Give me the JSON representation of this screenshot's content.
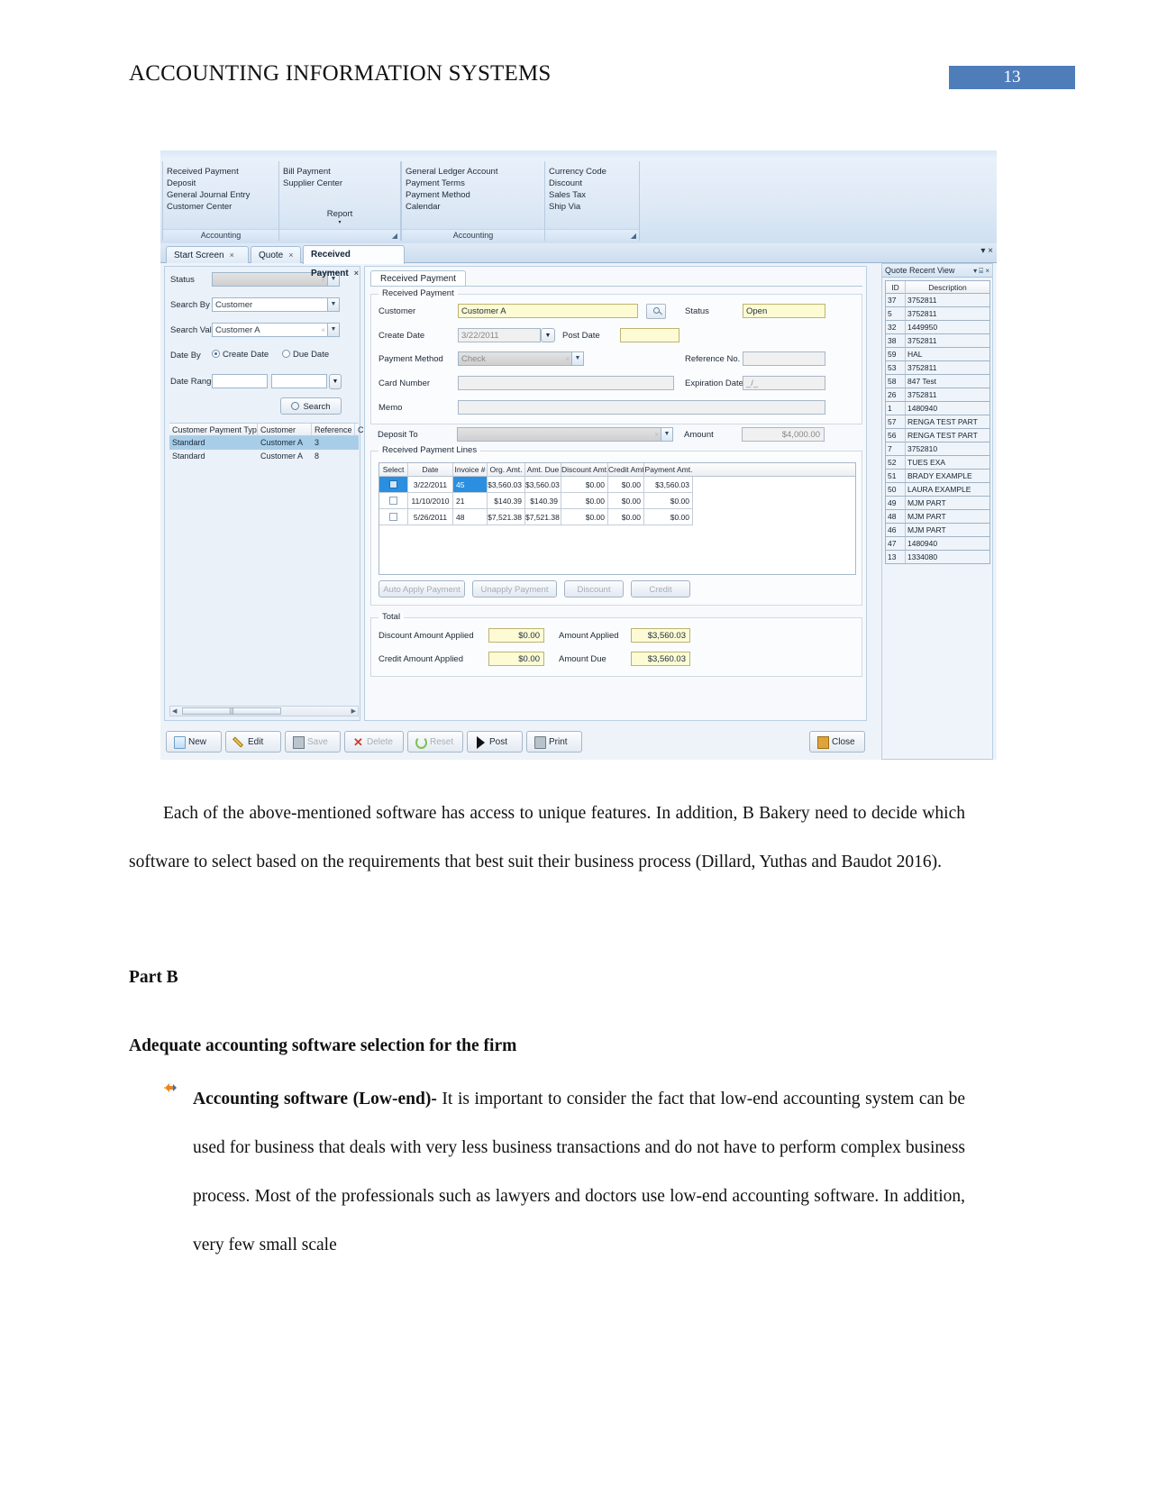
{
  "header": {
    "running_title": "ACCOUNTING INFORMATION SYSTEMS",
    "page_number": "13",
    "accent_color": "#4f7dba"
  },
  "screenshot": {
    "ribbon": {
      "group1": {
        "caption": "Accounting",
        "items": [
          "Received Payment",
          "Deposit",
          "General Journal Entry",
          "Customer Center"
        ]
      },
      "group2": {
        "items": [
          "Bill Payment",
          "Supplier Center"
        ],
        "report_label": "Report"
      },
      "group3": {
        "caption": "Accounting",
        "items": [
          "General Ledger Account",
          "Payment Terms",
          "Payment Method",
          "Calendar"
        ]
      },
      "group4": {
        "items": [
          "Currency Code",
          "Discount",
          "Sales Tax",
          "Ship Via"
        ]
      }
    },
    "tabs": [
      {
        "label": "Start Screen",
        "close": "×",
        "active": false
      },
      {
        "label": "Quote",
        "close": "×",
        "active": false
      },
      {
        "label": "Received Payment",
        "close": "×",
        "active": true
      }
    ],
    "tabstrip_controls": "▾ ×",
    "search_panel": {
      "labels": {
        "status": "Status",
        "search_by": "Search By",
        "search_value": "Search Value",
        "date_by": "Date By",
        "date_range": "Date Range"
      },
      "status_value": "",
      "search_by_value": "Customer",
      "search_value_value": "Customer A",
      "date_by_options": [
        "Create Date",
        "Due Date"
      ],
      "date_by_selected": "Create Date",
      "date_range_from": "",
      "date_range_to": "",
      "search_button": "Search",
      "results_columns": [
        "Customer Payment Type",
        "Customer",
        "Reference No.",
        "Cr"
      ],
      "results_rows": [
        {
          "type": "Standard",
          "customer": "Customer A",
          "ref": "3",
          "selected": true
        },
        {
          "type": "Standard",
          "customer": "Customer A",
          "ref": "8",
          "selected": false
        }
      ]
    },
    "form": {
      "inner_tab": "Received Payment",
      "group_title": "Received Payment",
      "fields": {
        "customer_label": "Customer",
        "customer_value": "Customer A",
        "status_label": "Status",
        "status_value": "Open",
        "create_date_label": "Create Date",
        "create_date_value": "3/22/2011",
        "post_date_label": "Post Date",
        "post_date_value": "",
        "payment_method_label": "Payment Method",
        "payment_method_value": "Check",
        "reference_no_label": "Reference No.",
        "reference_no_value": "",
        "card_number_label": "Card Number",
        "card_number_value": "",
        "expiration_date_label": "Expiration Date",
        "expiration_date_value": "_/_",
        "memo_label": "Memo",
        "memo_value": "",
        "deposit_to_label": "Deposit To",
        "deposit_to_value": "",
        "amount_label": "Amount",
        "amount_value": "$4,000.00"
      },
      "lines_group_title": "Received Payment Lines",
      "lines_columns": [
        "Select",
        "Date",
        "Invoice #",
        "Org. Amt.",
        "Amt. Due",
        "Discount Amt.",
        "Credit Amt.",
        "Payment Amt."
      ],
      "lines_rows": [
        {
          "selected": true,
          "date": "3/22/2011",
          "invoice": "45",
          "org": "$3,560.03",
          "due": "$3,560.03",
          "discount": "$0.00",
          "credit": "$0.00",
          "payment": "$3,560.03"
        },
        {
          "selected": false,
          "date": "11/10/2010",
          "invoice": "21",
          "org": "$140.39",
          "due": "$140.39",
          "discount": "$0.00",
          "credit": "$0.00",
          "payment": "$0.00"
        },
        {
          "selected": false,
          "date": "5/26/2011",
          "invoice": "48",
          "org": "$7,521.38",
          "due": "$7,521.38",
          "discount": "$0.00",
          "credit": "$0.00",
          "payment": "$0.00"
        }
      ],
      "line_buttons": [
        "Auto Apply Payment",
        "Unapply Payment",
        "Discount",
        "Credit"
      ],
      "total": {
        "group_title": "Total",
        "discount_amount_applied_label": "Discount Amount Applied",
        "discount_amount_applied_value": "$0.00",
        "amount_applied_label": "Amount Applied",
        "amount_applied_value": "$3,560.03",
        "credit_amount_applied_label": "Credit Amount Applied",
        "credit_amount_applied_value": "$0.00",
        "amount_due_label": "Amount Due",
        "amount_due_value": "$3,560.03"
      }
    },
    "recent_view": {
      "title": "Quote Recent View",
      "controls": "▾ ⌸ ×",
      "columns": [
        "ID",
        "Description"
      ],
      "rows": [
        {
          "id": "37",
          "description": "3752811"
        },
        {
          "id": "5",
          "description": "3752811"
        },
        {
          "id": "32",
          "description": "1449950"
        },
        {
          "id": "38",
          "description": "3752811"
        },
        {
          "id": "59",
          "description": "HAL"
        },
        {
          "id": "53",
          "description": "3752811"
        },
        {
          "id": "58",
          "description": "847 Test"
        },
        {
          "id": "26",
          "description": "3752811"
        },
        {
          "id": "1",
          "description": "1480940"
        },
        {
          "id": "57",
          "description": "RENGA TEST PART"
        },
        {
          "id": "56",
          "description": "RENGA TEST PART"
        },
        {
          "id": "7",
          "description": "3752810"
        },
        {
          "id": "52",
          "description": "TUES EXA"
        },
        {
          "id": "51",
          "description": "BRADY EXAMPLE"
        },
        {
          "id": "50",
          "description": "LAURA EXAMPLE"
        },
        {
          "id": "49",
          "description": "MJM PART"
        },
        {
          "id": "48",
          "description": "MJM PART"
        },
        {
          "id": "46",
          "description": "MJM PART"
        },
        {
          "id": "47",
          "description": "1480940"
        },
        {
          "id": "13",
          "description": "1334080"
        }
      ]
    },
    "action_bar": {
      "buttons": [
        {
          "label": "New",
          "disabled": false
        },
        {
          "label": "Edit",
          "disabled": false
        },
        {
          "label": "Save",
          "disabled": true
        },
        {
          "label": "Delete",
          "disabled": true
        },
        {
          "label": "Reset",
          "disabled": true
        },
        {
          "label": "Post",
          "disabled": false
        },
        {
          "label": "Print",
          "disabled": false
        }
      ],
      "close_label": "Close"
    }
  },
  "body": {
    "para1": "Each of the above-mentioned software has access to unique features. In addition, B Bakery need to decide which software to select based on the requirements that best suit their business process (Dillard, Yuthas and Baudot 2016).",
    "heading_part_b": "Part B",
    "heading_selection": "Adequate accounting software selection for the firm",
    "bullet1_bold": "Accounting software (Low-end)-",
    "bullet1_text": " It is important to consider the fact that low-end accounting system can be used for business that deals with very less business transactions and do not have to perform complex business process. Most of the professionals such as lawyers and doctors use low-end accounting software. In addition, very few small scale"
  }
}
